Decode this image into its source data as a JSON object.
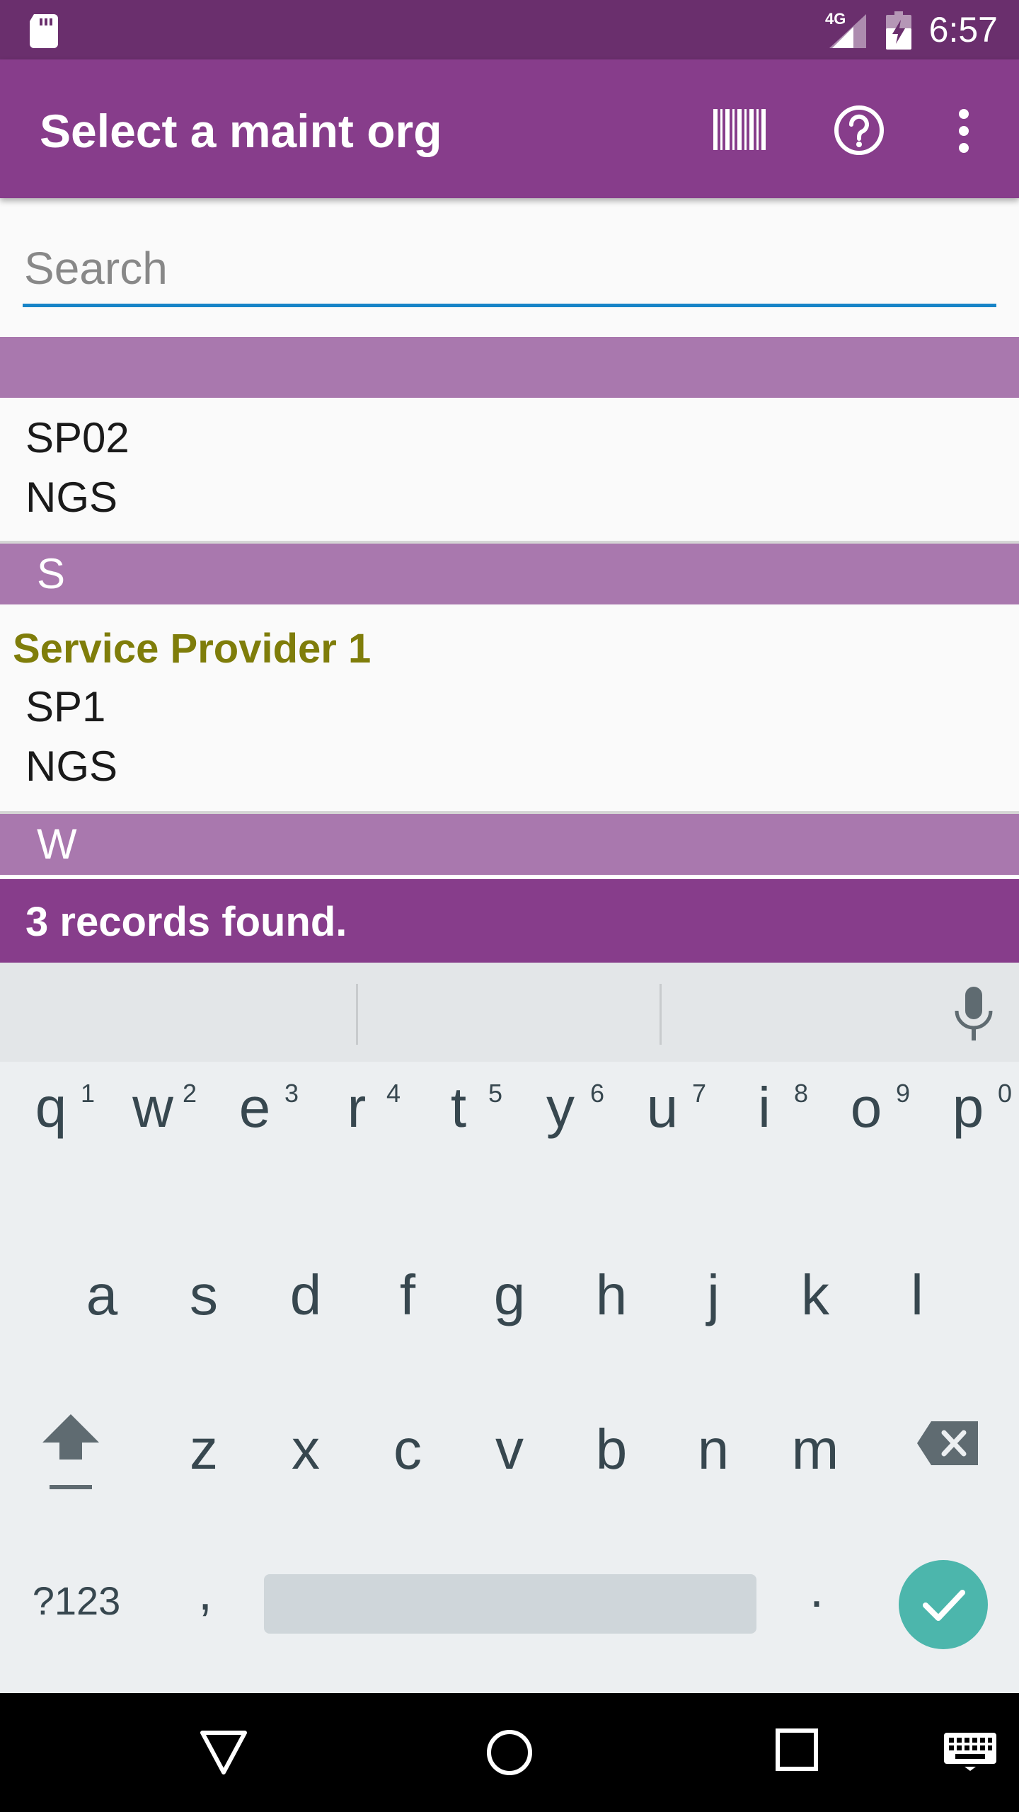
{
  "status_bar": {
    "network": "4G",
    "time": "6:57",
    "icons": [
      "sd-card-icon",
      "signal-icon",
      "battery-charging-icon"
    ]
  },
  "app_bar": {
    "title": "Select a maint org",
    "actions": [
      "barcode-icon",
      "help-icon",
      "more-vert-icon"
    ]
  },
  "search": {
    "placeholder": "Search",
    "value": ""
  },
  "list": {
    "sections": [
      {
        "header": "",
        "items": [
          {
            "title": "",
            "lines": [
              "SP02",
              "NGS"
            ]
          }
        ]
      },
      {
        "header": "S",
        "items": [
          {
            "title": "Service Provider 1",
            "lines": [
              "SP1",
              "NGS"
            ]
          }
        ]
      },
      {
        "header": "W",
        "items": []
      }
    ]
  },
  "records_status": "3 records found.",
  "keyboard": {
    "row1": [
      {
        "key": "q",
        "hint": "1"
      },
      {
        "key": "w",
        "hint": "2"
      },
      {
        "key": "e",
        "hint": "3"
      },
      {
        "key": "r",
        "hint": "4"
      },
      {
        "key": "t",
        "hint": "5"
      },
      {
        "key": "y",
        "hint": "6"
      },
      {
        "key": "u",
        "hint": "7"
      },
      {
        "key": "i",
        "hint": "8"
      },
      {
        "key": "o",
        "hint": "9"
      },
      {
        "key": "p",
        "hint": "0"
      }
    ],
    "row2": [
      "a",
      "s",
      "d",
      "f",
      "g",
      "h",
      "j",
      "k",
      "l"
    ],
    "row3": [
      "z",
      "x",
      "c",
      "v",
      "b",
      "n",
      "m"
    ],
    "symbols_label": "?123",
    "comma": ",",
    "period": ".",
    "icons": [
      "mic-icon",
      "shift-icon",
      "backspace-icon",
      "enter-check-icon"
    ]
  },
  "nav_bar": {
    "icons": [
      "back-icon",
      "home-icon",
      "recents-icon",
      "keyboard-switch-icon"
    ]
  },
  "colors": {
    "status_bar": "#6a2f6d",
    "app_bar": "#873d8b",
    "section_header": "#a978ae",
    "search_underline": "#1784c7",
    "item_title": "#7f7d0a",
    "keyboard_bg": "#eceff1",
    "enter_key": "#4cb6ac"
  }
}
